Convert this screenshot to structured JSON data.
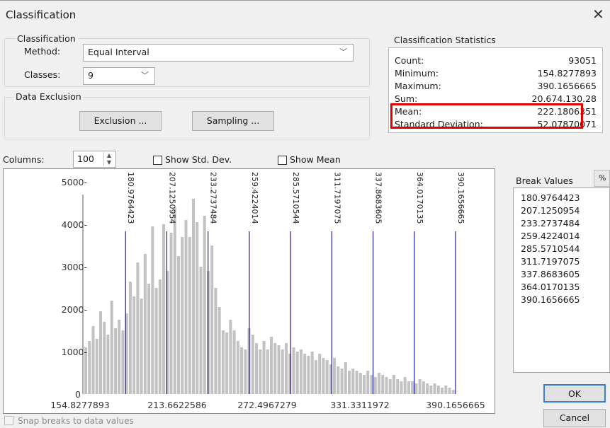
{
  "window": {
    "title": "Classification"
  },
  "classification": {
    "group_label": "Classification",
    "method_label": "Method:",
    "method_value": "Equal Interval",
    "classes_label": "Classes:",
    "classes_value": "9"
  },
  "exclusion": {
    "group_label": "Data Exclusion",
    "exclusion_button": "Exclusion ...",
    "sampling_button": "Sampling ..."
  },
  "stats": {
    "title": "Classification Statistics",
    "rows": [
      {
        "label": "Count:",
        "value": "93051"
      },
      {
        "label": "Minimum:",
        "value": "154.8277893"
      },
      {
        "label": "Maximum:",
        "value": "390.1656665"
      },
      {
        "label": "Sum:",
        "value": "20,674,130.28"
      },
      {
        "label": "Mean:",
        "value": "222.1806351"
      },
      {
        "label": "Standard Deviation:",
        "value": "52.07870071"
      }
    ]
  },
  "options": {
    "columns_label": "Columns:",
    "columns_value": "100",
    "show_std_dev": "Show Std. Dev.",
    "show_mean": "Show Mean",
    "snap_breaks": "Snap breaks to data values"
  },
  "breaks": {
    "header": "Break Values",
    "percent_label": "%",
    "values": [
      "180.9764423",
      "207.1250954",
      "233.2737484",
      "259.4224014",
      "285.5710544",
      "311.7197075",
      "337.8683605",
      "364.0170135",
      "390.1656665"
    ]
  },
  "buttons": {
    "ok": "OK",
    "cancel": "Cancel"
  },
  "colors": {
    "highlight": "#e00000",
    "bar": "#c2c2c2",
    "break_line": "#1c1c9c"
  },
  "chart_data": {
    "type": "bar",
    "xlim": [
      154.8277893,
      390.1656665
    ],
    "ylim": [
      0,
      5000
    ],
    "y_ticks": [
      "0",
      "1000-",
      "2000-",
      "3000-",
      "4000-",
      "5000-"
    ],
    "x_ticks": [
      "154.8277893",
      "213.6622586",
      "272.4967279",
      "331.3311972",
      "390.1656665"
    ],
    "bins": 100,
    "values": [
      1100,
      1250,
      1600,
      1300,
      1950,
      1700,
      1400,
      2200,
      1550,
      1750,
      1500,
      1900,
      2650,
      2300,
      3100,
      2250,
      3300,
      2600,
      3950,
      2500,
      2700,
      4000,
      2900,
      3800,
      4400,
      3250,
      3700,
      4100,
      3700,
      4600,
      4050,
      3000,
      4200,
      2900,
      3500,
      2500,
      2050,
      1500,
      1450,
      1750,
      1500,
      1250,
      1100,
      1050,
      1550,
      1400,
      1200,
      1050,
      1250,
      1050,
      1350,
      1200,
      1150,
      1050,
      1200,
      950,
      1100,
      1000,
      1050,
      950,
      900,
      1000,
      800,
      950,
      850,
      800,
      700,
      850,
      650,
      600,
      750,
      550,
      600,
      550,
      500,
      450,
      550,
      450,
      400,
      500,
      450,
      400,
      350,
      450,
      350,
      300,
      400,
      300,
      300,
      250,
      350,
      300,
      250,
      200,
      250,
      200,
      150,
      200,
      150,
      100
    ],
    "breaks": [
      180.9764423,
      207.1250954,
      233.2737484,
      259.4224014,
      285.5710544,
      311.7197075,
      337.8683605,
      364.0170135,
      390.1656665
    ],
    "break_labels": [
      "180.9764423",
      "207.1250954",
      "233.2737484",
      "259.4224014",
      "285.5710544",
      "311.7197075",
      "337.8683605",
      "364.0170135",
      "390.1656665"
    ]
  }
}
